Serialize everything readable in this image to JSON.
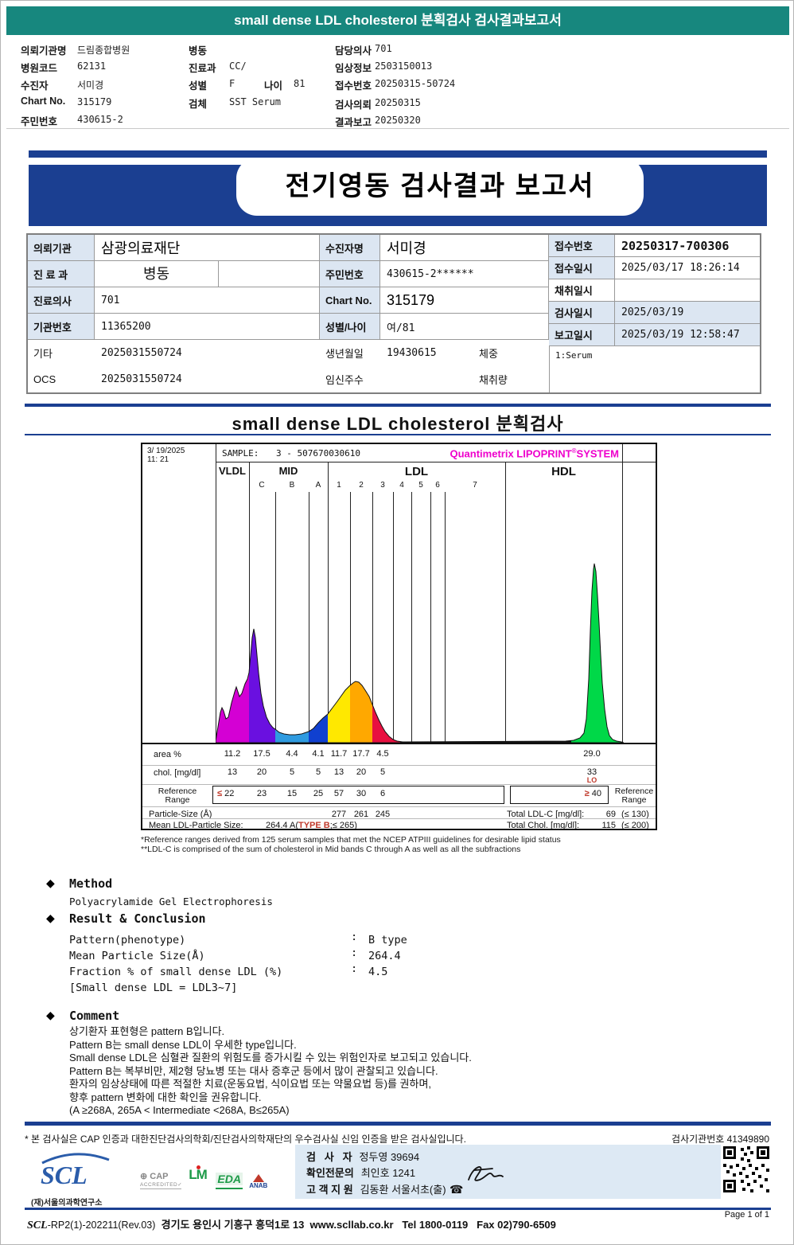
{
  "page": {
    "header_bar": "small dense LDL cholesterol 분획검사 검사결과보고서",
    "banner_title": "전기영동 검사결과 보고서",
    "section_title": "small dense LDL cholesterol 분획검사"
  },
  "colors": {
    "teal_header": "#17877e",
    "navy_accent": "#1b3f91",
    "label_cell_bg": "#dce6f2",
    "brand_magenta": "#ee00cc",
    "alert_red": "#c0392b"
  },
  "patient_header": {
    "col1": [
      {
        "label": "의뢰기관명",
        "value": "드림종합병원"
      },
      {
        "label": "병원코드",
        "value": "62131"
      },
      {
        "label": "수진자",
        "value": "서미경"
      },
      {
        "label": "Chart No.",
        "value": "315179"
      },
      {
        "label": "주민번호",
        "value": "430615-2"
      }
    ],
    "col2": [
      {
        "label": "병동",
        "value": ""
      },
      {
        "label": "진료과",
        "value": "CC/"
      },
      {
        "label": "성별",
        "value": "F",
        "label2": "나이",
        "value2": "81"
      },
      {
        "label": "검체",
        "value": "SST Serum"
      }
    ],
    "col3": [
      {
        "label": "담당의사",
        "value": "701"
      },
      {
        "label": "임상정보",
        "value": "2503150013"
      },
      {
        "label": "접수번호",
        "value": "20250315-50724"
      },
      {
        "label": "검사의뢰",
        "value": "20250315"
      },
      {
        "label": "결과보고",
        "value": "20250320"
      }
    ]
  },
  "report_table": {
    "left": [
      {
        "label": "의뢰기관",
        "value": "삼광의료재단"
      },
      {
        "label": "진 료 과",
        "value": "병동"
      },
      {
        "label": "진료의사",
        "value": "701"
      },
      {
        "label": "기관번호",
        "value": "11365200"
      },
      {
        "label": "기타",
        "value": "2025031550724"
      },
      {
        "label": "OCS",
        "value": "2025031550724"
      }
    ],
    "middle": [
      {
        "label": "수진자명",
        "value": "서미경"
      },
      {
        "label": "주민번호",
        "value": "430615-2******"
      },
      {
        "label": "Chart No.",
        "value": "315179"
      },
      {
        "label": "성별/나이",
        "value": "여/81"
      },
      {
        "label": "생년월일",
        "value": "19430615",
        "extra": "체중"
      },
      {
        "label": "임신주수",
        "value": "",
        "extra": "채취량"
      }
    ],
    "right": [
      {
        "label": "접수번호",
        "value": "20250317-700306"
      },
      {
        "label": "접수일시",
        "value": "2025/03/17 18:26:14"
      },
      {
        "label": "채취일시",
        "value": ""
      },
      {
        "label": "검사일시",
        "value": "2025/03/19"
      },
      {
        "label": "보고일시",
        "value": "2025/03/19 12:58:47"
      }
    ],
    "serum_note": "1:Serum"
  },
  "chart_data": {
    "type": "area",
    "title": "Quantimetrix LIPOPRINT SYSTEM lipoprotein subfraction profile",
    "datetime_line1": "3/ 19/2025",
    "datetime_line2": "11: 21",
    "sample_label": "SAMPLE:",
    "sample_id": "3 - 507670030610",
    "brand_1": "Quantimetrix LIPOPRINT",
    "brand_sup": "®",
    "brand_2": "SYSTEM",
    "groups": [
      "VLDL",
      "MID",
      "LDL",
      "HDL"
    ],
    "subbands": [
      "C",
      "B",
      "A",
      "1",
      "2",
      "3",
      "4",
      "5",
      "6",
      "7"
    ],
    "bands": [
      {
        "name": "VLDL",
        "area_pct": "11.2",
        "chol": "13",
        "ref": "22",
        "color": "#d400d4"
      },
      {
        "name": "MID C",
        "area_pct": "17.5",
        "chol": "20",
        "ref": "23",
        "color": "#6a10e0"
      },
      {
        "name": "MID B",
        "area_pct": "4.4",
        "chol": "5",
        "ref": "15",
        "color": "#2f9be0"
      },
      {
        "name": "MID A",
        "area_pct": "4.1",
        "chol": "5",
        "ref": "25",
        "color": "#1040d0"
      },
      {
        "name": "LDL 1",
        "area_pct": "11.7",
        "chol": "13",
        "ref": "57",
        "color": "#ffe800"
      },
      {
        "name": "LDL 2",
        "area_pct": "17.7",
        "chol": "20",
        "ref": "30",
        "color": "#ffa800"
      },
      {
        "name": "LDL 3",
        "area_pct": "4.5",
        "chol": "5",
        "ref": "6",
        "color": "#e81040"
      },
      {
        "name": "HDL",
        "area_pct": "29.0",
        "chol": "33",
        "flag": "LO",
        "ref": "40",
        "color": "#00d848"
      }
    ],
    "row_labels": {
      "area": "area %",
      "chol": "chol. [mg/dl]",
      "ref1": "Reference",
      "ref2": "Range",
      "particle": "Particle-Size (Å)",
      "mean": "Mean LDL-Particle Size:"
    },
    "ref_leq": "≤",
    "ref_geq": "≥",
    "particle_sizes": [
      "277",
      "261",
      "245"
    ],
    "mean_value_1": "264.4 A(",
    "mean_type": "TYPE B",
    "mean_value_2": ";≤ 265)",
    "totals": {
      "ldl_label": "Total LDL-C [mg/dl]:",
      "ldl_value": "69",
      "ldl_ref": "(≤ 130)",
      "chol_label": "Total Chol. [mg/dl]:",
      "chol_value": "115",
      "chol_ref": "(≤ 200)"
    },
    "footnote1": "*Reference ranges derived from 125 serum samples that met the NCEP ATPIII guidelines for desirable lipid status",
    "footnote2": "**LDL-C is comprised of the sum of cholesterol in Mid bands C through A as well as all the subfractions"
  },
  "method": {
    "bullet": "◆",
    "heading": "Method",
    "body": "Polyacrylamide Gel Electrophoresis",
    "result_heading": "Result & Conclusion",
    "colon": ":",
    "rows": [
      {
        "label": "Pattern(phenotype)",
        "value": "B type"
      },
      {
        "label": "Mean Particle Size(Å)",
        "value": "264.4"
      },
      {
        "label": "Fraction % of small dense LDL (%)",
        "value": "4.5"
      }
    ],
    "note": "[Small dense LDL = LDL3~7]"
  },
  "comment": {
    "bullet": "◆",
    "heading": "Comment",
    "lines": [
      "상기환자 표현형은 pattern B입니다.",
      "Pattern B는 small dense LDL이 우세한 type입니다.",
      "Small dense LDL은 심혈관 질환의 위험도를 증가시킬 수 있는 위험인자로 보고되고 있습니다.",
      "Pattern B는 복부비만, 제2형 당뇨병 또는 대사 증후군 등에서 많이 관찰되고 있습니다.",
      "환자의 임상상태에 따른 적절한 치료(운동요법, 식이요법 또는 약물요법 등)를 권하며,",
      "향후 pattern 변화에 대한 확인을 권유합니다.",
      "(A ≥268A, 265A < Intermediate <268A, B≤265A)"
    ]
  },
  "footer": {
    "cert_note": "* 본 검사실은 CAP 인증과 대한진단검사의학회/진단검사의학재단의 우수검사실 신임 인증을 받은 검사실입니다.",
    "lab_no": "검사기관번호 41349890",
    "logo_text": "SCL",
    "logo_sub": "(재)서울의과학연구소",
    "cert_logos": {
      "cap1": "CAP",
      "cap2": "ACCREDITED✓",
      "lm": "LM",
      "eda": "EDA",
      "anab": "ANAB"
    },
    "signers": [
      {
        "label": "검   사   자",
        "value": "정두영 39694"
      },
      {
        "label": "확인전문의",
        "value": "최인호 1241"
      },
      {
        "label": "고 객 지 원",
        "value": "김동환 서울서초(출)"
      }
    ],
    "phone_icon": "☎",
    "doc_no_prefix": "SCL",
    "doc_no": "-RP2(1)-202211(Rev.03)",
    "address": "경기도 용인시 기흥구 흥덕1로 13",
    "website": "www.scllab.co.kr",
    "tel": "Tel 1800-0119",
    "fax": "Fax 02)790-6509",
    "page": "Page 1 of 1"
  }
}
